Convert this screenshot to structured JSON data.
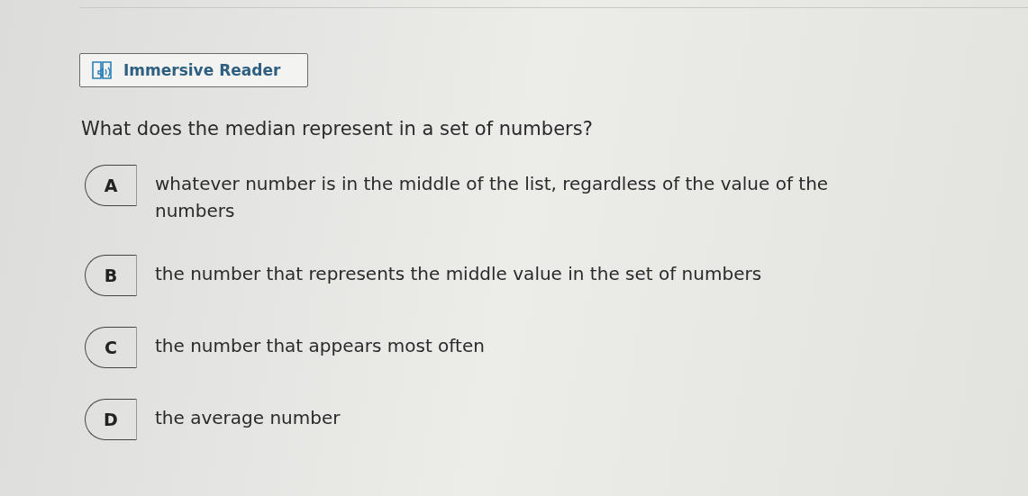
{
  "reader_button": {
    "label": "Immersive Reader"
  },
  "question": "What does the median represent in a set of numbers?",
  "options": [
    {
      "letter": "A",
      "text": "whatever number is in the middle of the list, regardless of the value of the numbers",
      "selected": false
    },
    {
      "letter": "B",
      "text": "the number that represents the middle value in the set of numbers",
      "selected": false
    },
    {
      "letter": "C",
      "text": "the number that appears most often",
      "selected": false
    },
    {
      "letter": "D",
      "text": "the average number",
      "selected": false
    }
  ]
}
